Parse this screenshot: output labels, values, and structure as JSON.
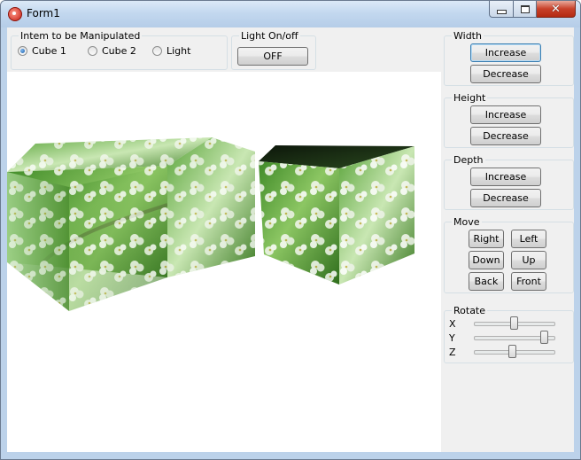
{
  "window": {
    "title": "Form1"
  },
  "manipulate": {
    "label": "Intem to be Manipulated",
    "options": [
      {
        "label": "Cube 1",
        "checked": true
      },
      {
        "label": "Cube 2",
        "checked": false
      },
      {
        "label": "Light",
        "checked": false
      }
    ]
  },
  "light": {
    "label": "Light On/off",
    "button": "OFF"
  },
  "width": {
    "label": "Width",
    "increase": "Increase",
    "decrease": "Decrease"
  },
  "height": {
    "label": "Height",
    "increase": "Increase",
    "decrease": "Decrease"
  },
  "depth": {
    "label": "Depth",
    "increase": "Increase",
    "decrease": "Decrease"
  },
  "move": {
    "label": "Move",
    "right": "Right",
    "left": "Left",
    "down": "Down",
    "up": "Up",
    "back": "Back",
    "front": "Front"
  },
  "rotate": {
    "label": "Rotate",
    "axes": [
      {
        "label": "X",
        "value": 0.5
      },
      {
        "label": "Y",
        "value": 0.93
      },
      {
        "label": "Z",
        "value": 0.48
      }
    ]
  },
  "icons": [
    "app-icon",
    "minimize-icon",
    "maximize-icon",
    "close-icon"
  ],
  "colors": {
    "leaf_green": "#4f9a2c",
    "blossom_white": "#f6f8f2"
  }
}
